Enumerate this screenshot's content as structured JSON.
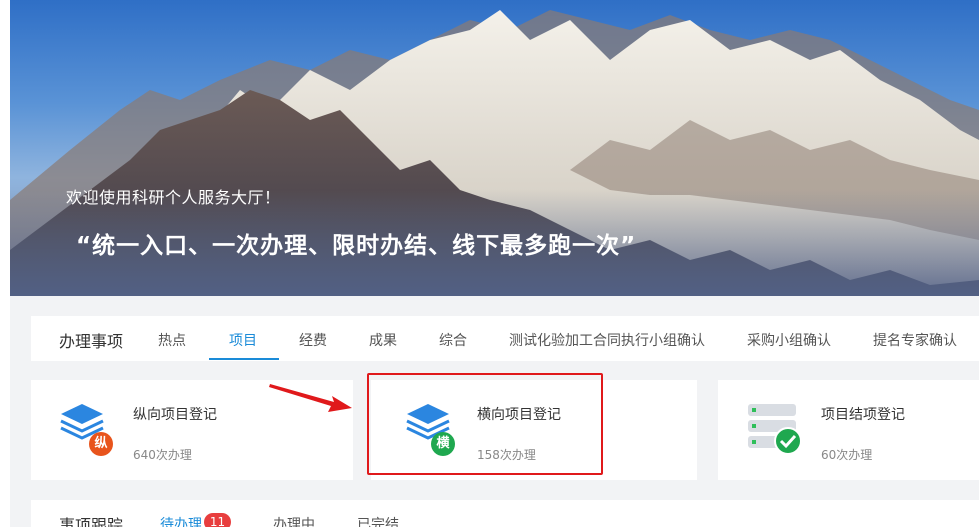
{
  "banner": {
    "welcome": "欢迎使用科研个人服务大厅！",
    "slogan": "“统一入口、一次办理、限时办结、线下最多跑一次”"
  },
  "tabs": {
    "title": "办理事项",
    "items": [
      "热点",
      "项目",
      "经费",
      "成果",
      "综合",
      "测试化验加工合同执行小组确认",
      "采购小组确认",
      "提名专家确认"
    ],
    "active": "项目"
  },
  "cards": [
    {
      "title": "纵向项目登记",
      "count": "640次办理",
      "badge": "纵",
      "badge_color": "#e8541c",
      "icon": "layers-icon"
    },
    {
      "title": "横向项目登记",
      "count": "158次办理",
      "badge": "横",
      "badge_color": "#1fa84f",
      "icon": "layers-icon"
    },
    {
      "title": "项目结项登记",
      "count": "60次办理",
      "badge": "",
      "badge_color": "#1fa84f",
      "icon": "server-check-icon"
    }
  ],
  "tracking": {
    "title": "事项跟踪",
    "tabs": [
      "待办理",
      "办理中",
      "已完结"
    ],
    "pending_count": "11"
  },
  "colors": {
    "accent": "#1a8bd8",
    "highlight": "#e0191b",
    "arrow": "#e0191b"
  }
}
